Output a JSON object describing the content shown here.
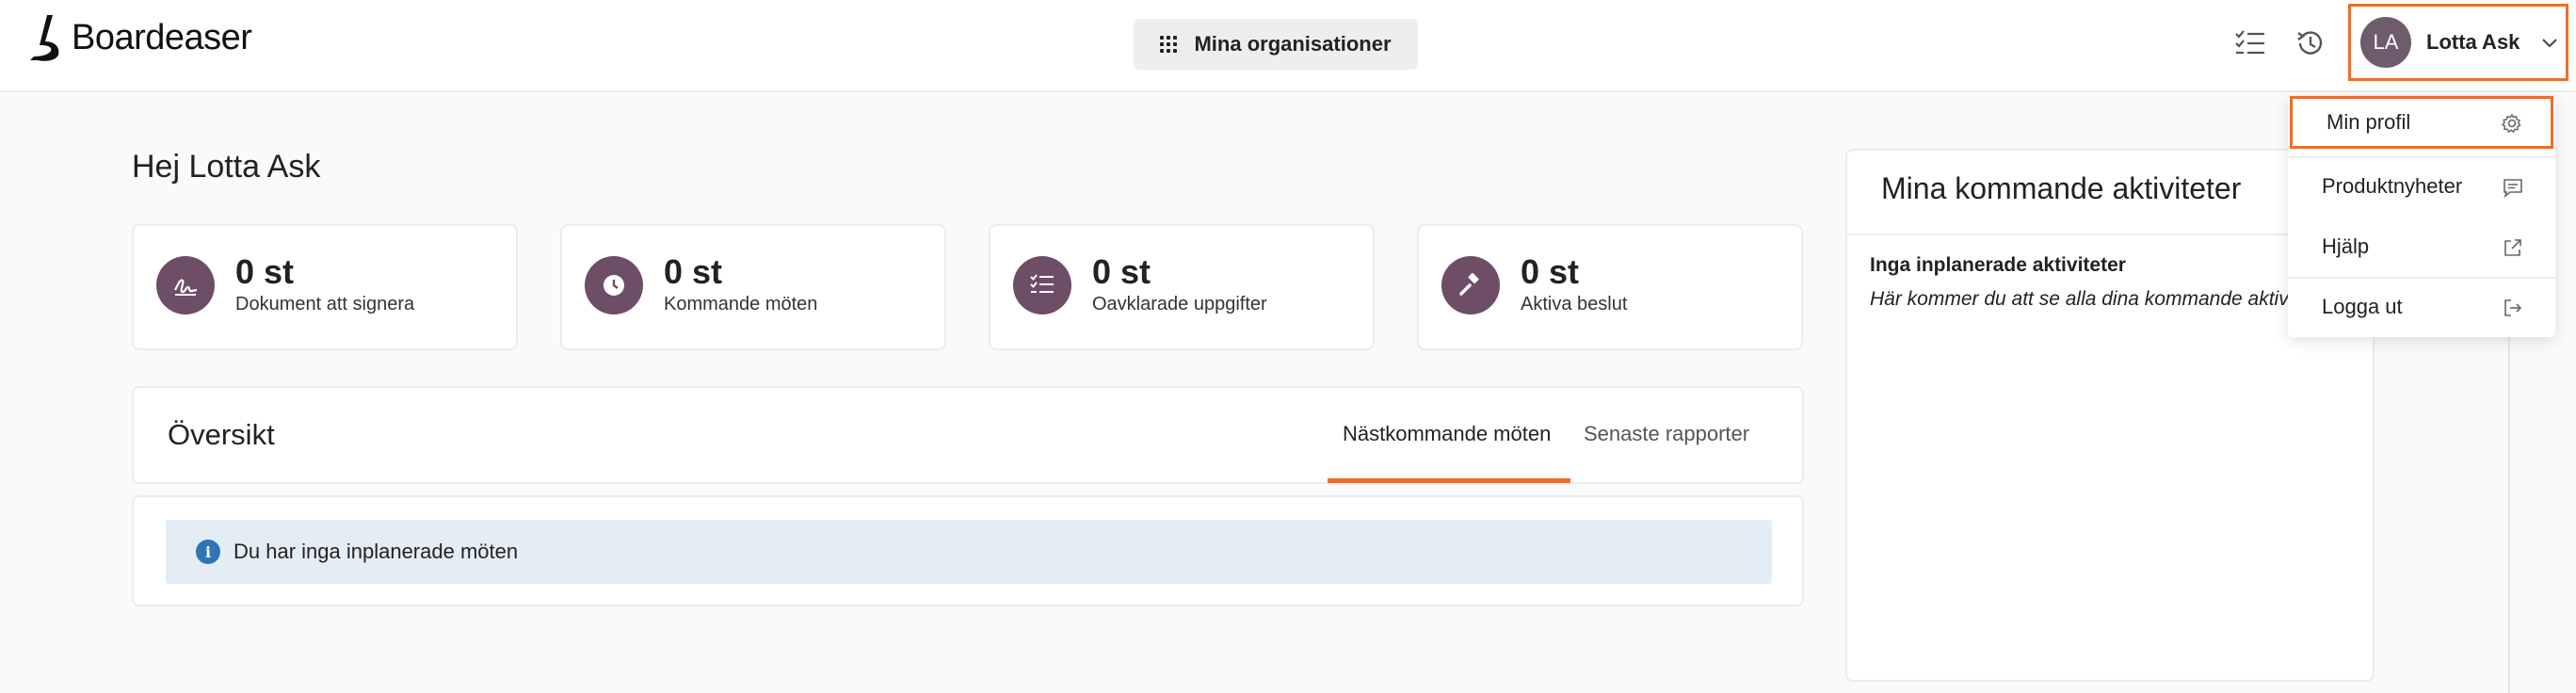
{
  "header": {
    "logo_text": "Boardeaser",
    "org_button_label": "Mina organisationer",
    "user": {
      "initials": "LA",
      "name": "Lotta Ask"
    }
  },
  "greeting": "Hej Lotta Ask",
  "stats": [
    {
      "value": "0 st",
      "label": "Dokument att signera",
      "icon": "signature-icon"
    },
    {
      "value": "0 st",
      "label": "Kommande möten",
      "icon": "clock-icon"
    },
    {
      "value": "0 st",
      "label": "Oavklarade uppgifter",
      "icon": "checklist-icon"
    },
    {
      "value": "0 st",
      "label": "Aktiva beslut",
      "icon": "gavel-icon"
    }
  ],
  "overview": {
    "title": "Översikt",
    "tabs": [
      {
        "label": "Nästkommande möten",
        "active": true
      },
      {
        "label": "Senaste rapporter",
        "active": false
      }
    ],
    "info_message": "Du har inga inplanerade möten"
  },
  "activities": {
    "title": "Mina kommande aktiviteter",
    "empty_title": "Inga inplanerade aktiviteter",
    "empty_text": "Här kommer du att se alla dina kommande aktiviteter."
  },
  "user_menu": {
    "items": [
      {
        "label": "Min profil",
        "icon": "gear-icon"
      },
      {
        "label": "Produktnyheter",
        "icon": "comment-icon"
      },
      {
        "label": "Hjälp",
        "icon": "external-link-icon"
      },
      {
        "label": "Logga ut",
        "icon": "logout-icon"
      }
    ]
  },
  "colors": {
    "accent": "#ee6c2c",
    "icon_bg": "#6e4d67",
    "avatar_bg": "#6e5c6d",
    "info_bg": "#e4edf4"
  }
}
